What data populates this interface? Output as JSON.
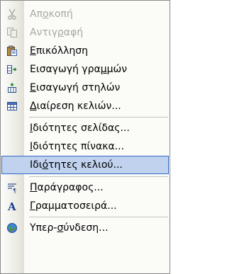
{
  "menu": {
    "items": [
      {
        "label": "Αποκοπή",
        "icon": "scissors-icon",
        "disabled": true,
        "accel_index": 2
      },
      {
        "label": "Αντιγραφή",
        "icon": "copy-icon",
        "disabled": true,
        "accel_index": 5
      },
      {
        "label": "Επικόλληση",
        "icon": "paste-icon",
        "disabled": false,
        "accel_index": 0
      },
      {
        "label": "Εισαγωγή γραμμών",
        "icon": "insert-rows-icon",
        "disabled": false,
        "accel_index": 12
      },
      {
        "label": "Εισαγωγή στηλών",
        "icon": "insert-columns-icon",
        "disabled": false,
        "accel_index": 0
      },
      {
        "label": "Διαίρεση κελιών...",
        "icon": "split-cells-icon",
        "disabled": false,
        "accel_index": 0
      },
      {
        "label": "Ιδιότητες σελίδας...",
        "icon": "",
        "disabled": false,
        "accel_index": 0
      },
      {
        "label": "Ιδιότητες πίνακα...",
        "icon": "",
        "disabled": false,
        "accel_index": 0
      },
      {
        "label": "Ιδιότητες κελιού...",
        "icon": "",
        "disabled": false,
        "accel_index": 3,
        "highlighted": true
      },
      {
        "label": "Παράγραφος...",
        "icon": "paragraph-icon",
        "disabled": false,
        "accel_index": 0
      },
      {
        "label": "Γραμματοσειρά...",
        "icon": "font-icon",
        "disabled": false,
        "accel_index": 0
      },
      {
        "label": "Υπερ-σύνδεση...",
        "icon": "hyperlink-icon",
        "disabled": false,
        "accel_index": 5
      }
    ]
  },
  "colors": {
    "highlight_bg": "#c1d2ee",
    "highlight_border": "#316ac5",
    "disabled_text": "#a8a7a0"
  }
}
